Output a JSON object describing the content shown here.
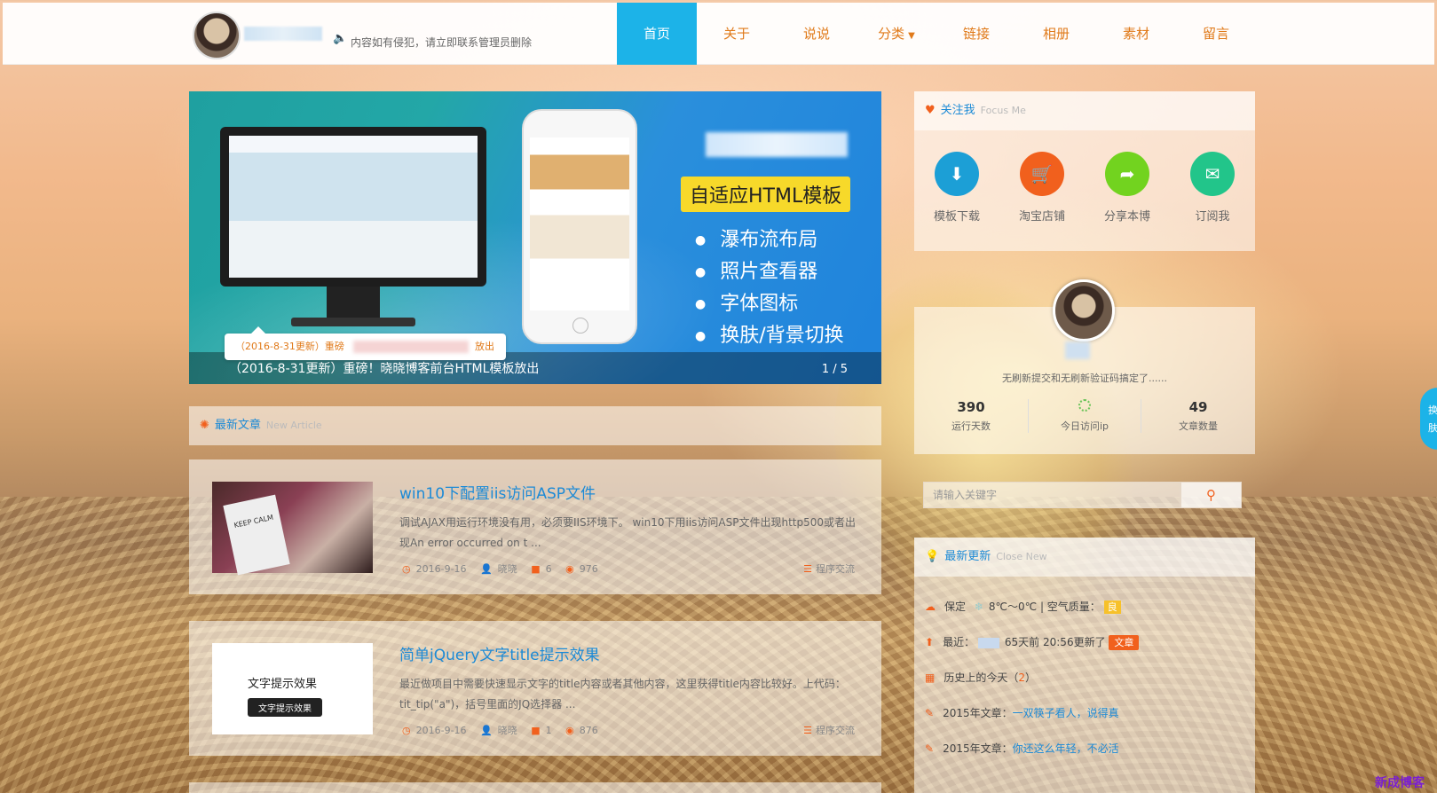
{
  "header": {
    "notice": "内容如有侵犯，请立即联系管理员删除",
    "nav": [
      {
        "label": "首页",
        "active": true
      },
      {
        "label": "关于"
      },
      {
        "label": "说说"
      },
      {
        "label": "分类",
        "dropdown": true
      },
      {
        "label": "链接"
      },
      {
        "label": "相册"
      },
      {
        "label": "素材"
      },
      {
        "label": "留言"
      }
    ]
  },
  "slider": {
    "badge": "自适应HTML模板",
    "features": [
      "瀑布流布局",
      "照片查看器",
      "字体图标",
      "换肤/背景切换"
    ],
    "caption": "（2016-8-31更新）重磅！晓晓博客前台HTML模板放出",
    "counter": "1 / 5",
    "tooltip_prefix": "（2016-8-31更新）重磅",
    "tooltip_suffix": "放出"
  },
  "latest_articles": {
    "title": "最新文章",
    "subtitle": "New Article",
    "items": [
      {
        "title": "win10下配置iis访问ASP文件",
        "excerpt": "调试AJAX用运行环境没有用，必须要IIS环境下。 win10下用iis访问ASP文件出现http500或者出现An error occurred on t ...",
        "date": "2016-9-16",
        "author": "晓晓",
        "comments": "6",
        "views": "976",
        "category": "程序交流",
        "thumb_text": "KEEP CALM"
      },
      {
        "title": "简单jQuery文字title提示效果",
        "excerpt": "最近做项目中需要快速显示文字的title内容或者其他内容，这里获得title内容比较好。上代码：  tit_tip(\"a\")，括号里面的JQ选择器 ...",
        "date": "2016-9-16",
        "author": "晓晓",
        "comments": "1",
        "views": "876",
        "category": "程序交流",
        "thumb_text": "文字提示效果",
        "thumb_tip": "文字提示效果"
      }
    ]
  },
  "sidebar": {
    "follow": {
      "title": "关注我",
      "subtitle": "Focus Me",
      "items": [
        {
          "label": "模板下载",
          "icon": "download-icon",
          "color": "#1c9fd6"
        },
        {
          "label": "淘宝店铺",
          "icon": "cart-icon",
          "color": "#f1601d"
        },
        {
          "label": "分享本博",
          "icon": "share-icon",
          "color": "#72d31f"
        },
        {
          "label": "订阅我",
          "icon": "mail-icon",
          "color": "#22c58a"
        }
      ]
    },
    "profile": {
      "desc": "无刷新提交和无刷新验证码搞定了......",
      "stats": [
        {
          "num": "390",
          "label": "运行天数"
        },
        {
          "num": "",
          "label": "今日访问ip"
        },
        {
          "num": "49",
          "label": "文章数量"
        }
      ]
    },
    "search": {
      "placeholder": "请输入关键字"
    },
    "news": {
      "title": "最新更新",
      "subtitle": "Close New",
      "weather_city": "保定",
      "weather_temp": "8℃～0℃ | 空气质量：",
      "air_quality": "良",
      "recent_prefix": "最近：",
      "recent_text": "65天前 20:56更新了",
      "recent_tag": "文章",
      "history_text": "历史上的今天（",
      "history_count": "2",
      "history_close": "）",
      "post1_prefix": "2015年文章：",
      "post1_link": "一双筷子看人，说得真",
      "post2_prefix": "2015年文章：",
      "post2_link": "你还这么年轻，不必活"
    }
  },
  "float_tab": {
    "line1": "换",
    "line2": "肤"
  },
  "watermark": "新成博客",
  "colors": {
    "accent": "#1cb3e8",
    "orange": "#f1601d",
    "link": "#1c8ad6"
  }
}
